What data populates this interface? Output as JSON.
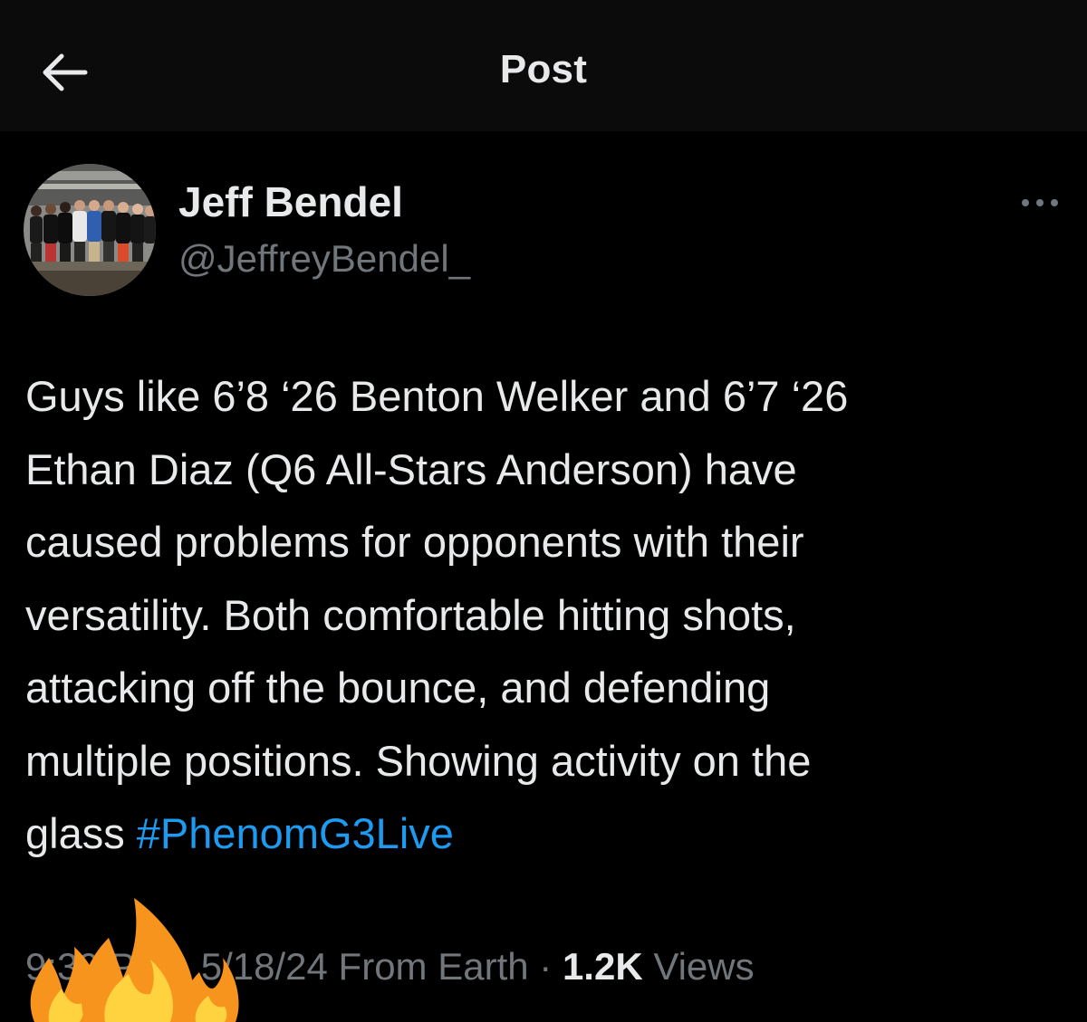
{
  "header": {
    "title": "Post",
    "back_icon": "arrow-left-icon"
  },
  "author": {
    "name": "Jeff Bendel",
    "handle": "@JeffreyBendel_"
  },
  "post": {
    "text": "Guys like 6’8 ‘26 Benton Welker and 6’7 ‘26\nEthan Diaz (Q6 All-Stars Anderson) have\ncaused problems for opponents with their\nversatility. Both comfortable hitting shots,\nattacking off the bounce, and defending\nmultiple positions. Showing activity on the\nglass ",
    "hashtag": "#PhenomG3Live"
  },
  "meta": {
    "time": "9:39 PM",
    "dot1": " · ",
    "date": "5/18/24",
    "source": " From Earth",
    "dot2": " · ",
    "views_count": "1.2K",
    "views_label": " Views"
  },
  "colors": {
    "background": "#000000",
    "header_background": "#0b0b0b",
    "text": "#e7e9ea",
    "secondary": "#71767b",
    "link": "#1d9bf0"
  },
  "overlay": {
    "emoji": "fire-emoji"
  }
}
